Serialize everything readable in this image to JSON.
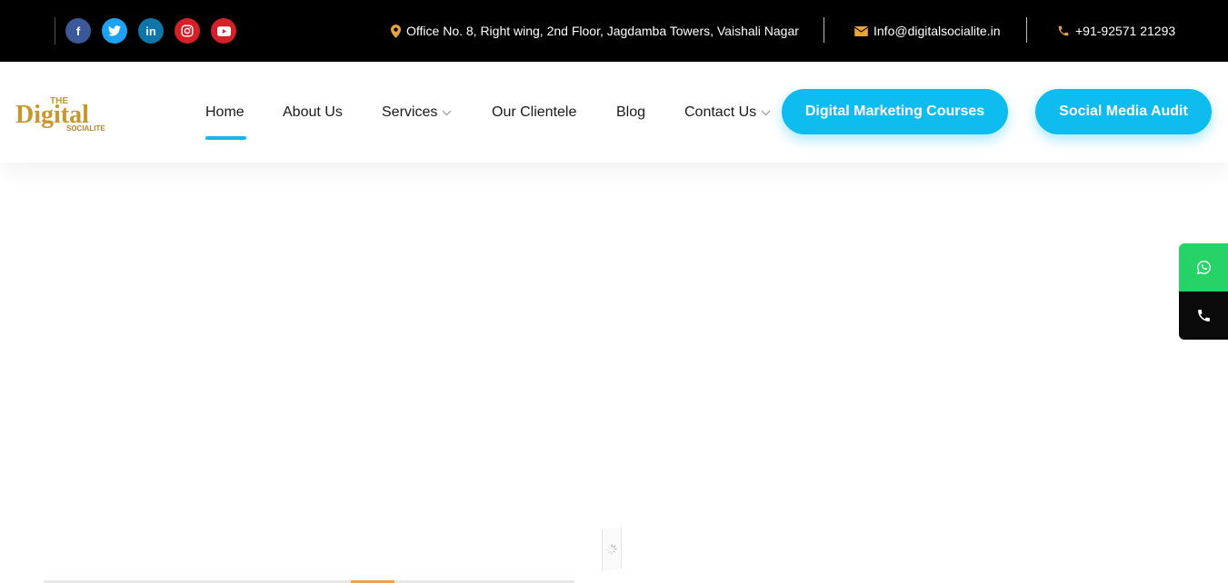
{
  "topbar": {
    "social": [
      {
        "name": "facebook-icon",
        "glyph": "f"
      },
      {
        "name": "twitter-icon",
        "glyph": ""
      },
      {
        "name": "linkedin-icon",
        "glyph": "in"
      },
      {
        "name": "instagram-icon",
        "glyph": ""
      },
      {
        "name": "youtube-icon",
        "glyph": ""
      }
    ],
    "address": "Office No. 8, Right wing, 2nd Floor, Jagdamba Towers, Vaishali Nagar",
    "email": "Info@digitalsocialite.in",
    "phone": "+91-92571 21293",
    "icon_color": "#e8a33d"
  },
  "header": {
    "logo": {
      "line1": "THE",
      "line2": "Digital",
      "line3": "SOCIALITE",
      "color": "#c9962b"
    },
    "nav": [
      {
        "label": "Home",
        "active": true
      },
      {
        "label": "About Us"
      },
      {
        "label": "Services",
        "dropdown": true
      },
      {
        "label": "Our Clientele"
      },
      {
        "label": "Blog"
      },
      {
        "label": "Contact Us",
        "dropdown": true
      }
    ],
    "cta_courses": "Digital Marketing Courses",
    "cta_audit": "Social Media Audit",
    "accent_color": "#0fbcf0"
  },
  "floating": {
    "whatsapp_icon": "whatsapp-icon",
    "phone_icon": "phone-icon",
    "whatsapp_color": "#25d366"
  }
}
